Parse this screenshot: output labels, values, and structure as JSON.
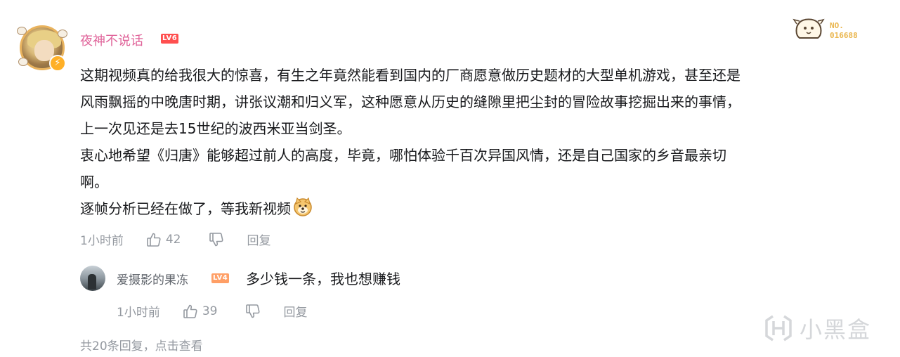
{
  "comment": {
    "username": "夜神不说话",
    "level": "LV6",
    "fan_badge": {
      "line1": "NO.",
      "line2": "016688"
    },
    "lines": [
      "这期视频真的给我很大的惊喜，有生之年竟然能看到国内的厂商愿意做历史题材的大型单机游戏，甚至还是",
      "风雨飘摇的中晚唐时期，讲张议潮和归义军，这种愿意从历史的缝隙里把尘封的冒险故事挖掘出来的事情，",
      "上一次见还是去15世纪的波西米亚当剑圣。",
      "衷心地希望《归唐》能够超过前人的高度，毕竟，哪怕体验千百次异国风情，还是自己国家的乡音最亲切",
      "啊。",
      "逐帧分析已经在做了，等我新视频"
    ],
    "time": "1小时前",
    "likes": "42",
    "reply_label": "回复"
  },
  "reply": {
    "username": "爱摄影的果冻",
    "level": "LV4",
    "text": "多少钱一条，我也想赚钱",
    "time": "1小时前",
    "likes": "39",
    "reply_label": "回复"
  },
  "more_replies": "共20条回复，点击查看",
  "watermark": "小黑盒",
  "icons": {
    "like": "thumbs-up-icon",
    "dislike": "thumbs-down-icon",
    "emoji": "doge-emoji-icon",
    "bolt": "lightning-icon"
  },
  "colors": {
    "username": "#e0649a",
    "lv6": "#ff4f4f",
    "lv4": "#ff9f66",
    "fan_badge": "#eab64e",
    "meta": "#9499a0"
  }
}
